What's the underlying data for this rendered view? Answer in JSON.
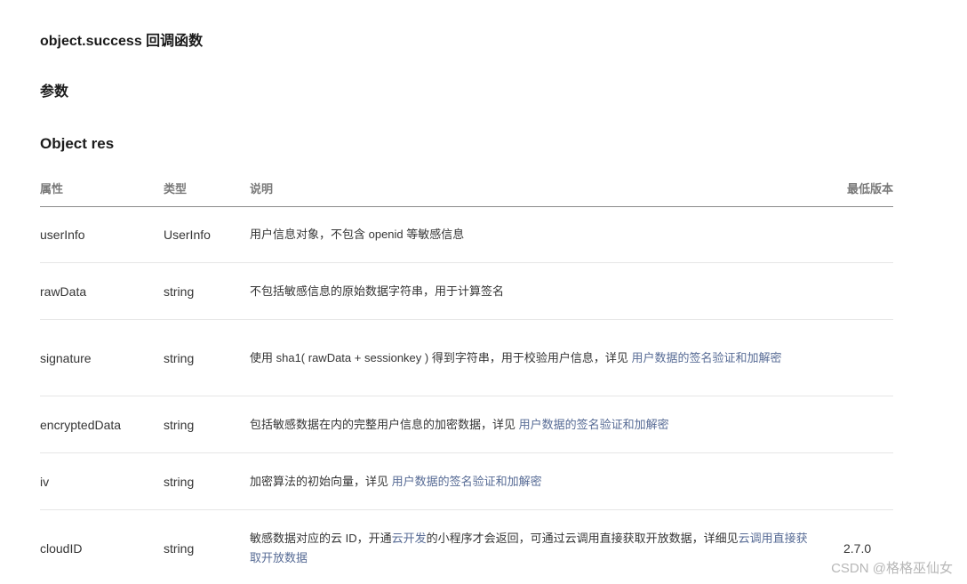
{
  "headings": {
    "callback": "object.success 回调函数",
    "params": "参数",
    "object": "Object res"
  },
  "table": {
    "headers": {
      "attr": "属性",
      "type": "类型",
      "desc": "说明",
      "version": "最低版本"
    },
    "rows": [
      {
        "attr": "userInfo",
        "type": "UserInfo",
        "desc_parts": [
          "用户信息对象，不包含 openid 等敏感信息"
        ],
        "version": ""
      },
      {
        "attr": "rawData",
        "type": "string",
        "desc_parts": [
          "不包括敏感信息的原始数据字符串，用于计算签名"
        ],
        "version": ""
      },
      {
        "attr": "signature",
        "type": "string",
        "desc_parts": [
          "使用 sha1( rawData + sessionkey ) 得到字符串，用于校验用户信息，详见 ",
          "用户数据的签名验证和加解密"
        ],
        "version": ""
      },
      {
        "attr": "encryptedData",
        "type": "string",
        "desc_parts": [
          "包括敏感数据在内的完整用户信息的加密数据，详见 ",
          "用户数据的签名验证和加解密"
        ],
        "version": ""
      },
      {
        "attr": "iv",
        "type": "string",
        "desc_parts": [
          "加密算法的初始向量，详见 ",
          "用户数据的签名验证和加解密"
        ],
        "version": ""
      },
      {
        "attr": "cloudID",
        "type": "string",
        "desc_parts": [
          "敏感数据对应的云 ID，开通",
          "云开发",
          "的小程序才会返回，可通过云调用直接获取开放数据，详细见",
          "云调用直接获取开放数据"
        ],
        "version": "2.7.0"
      }
    ]
  },
  "watermark": "CSDN @格格巫仙女",
  "colors": {
    "link": "#576b95",
    "text": "#353535",
    "header_text": "#7a7a7a",
    "divider": "#e6e6e6"
  }
}
